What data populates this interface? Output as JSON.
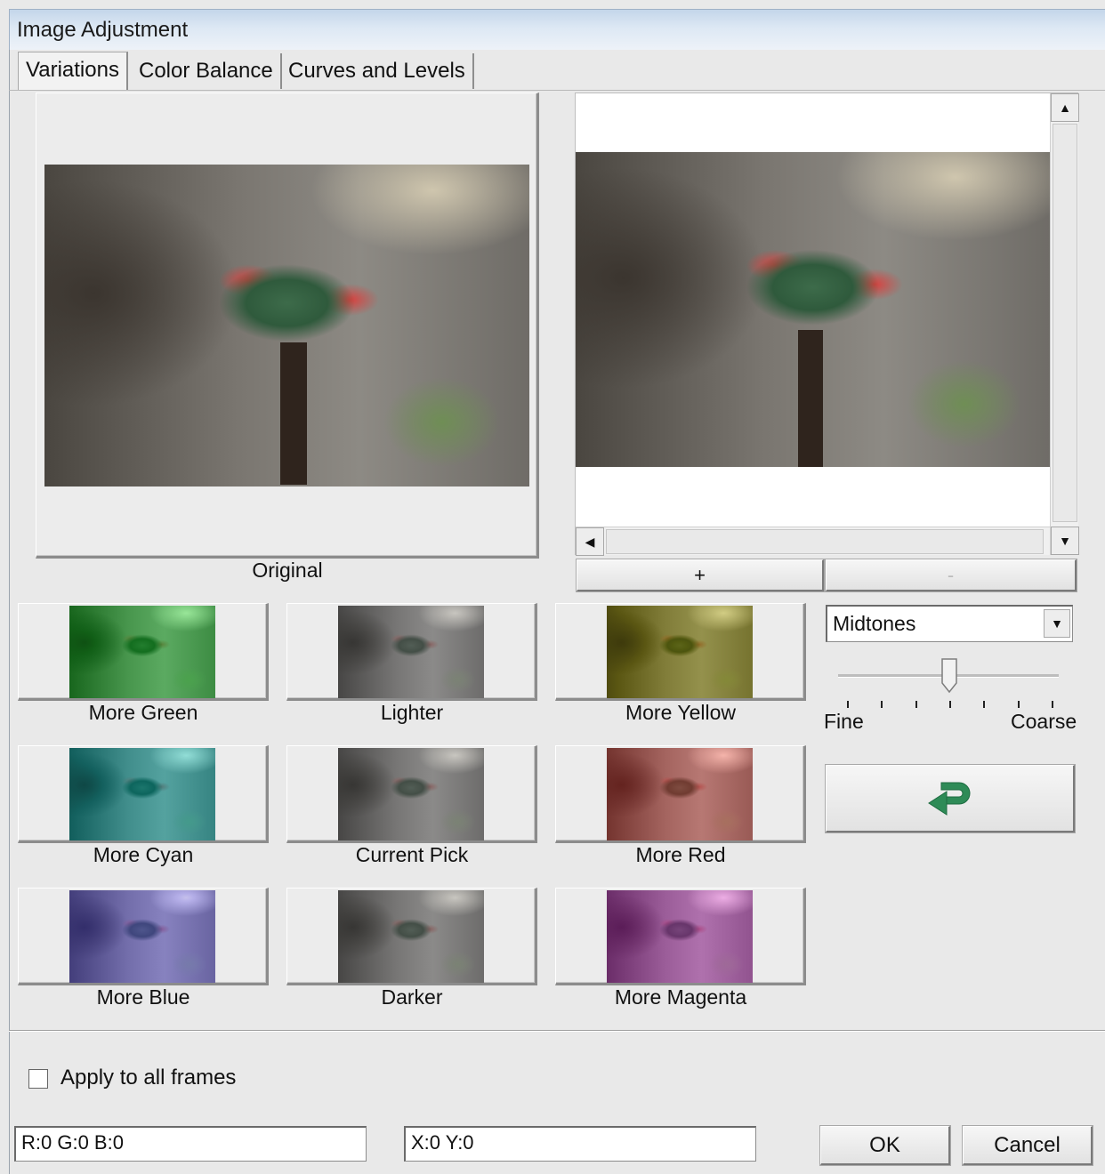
{
  "window": {
    "title": "Image Adjustment"
  },
  "tabs": [
    {
      "label": "Variations",
      "active": true
    },
    {
      "label": "Color Balance",
      "active": false
    },
    {
      "label": "Curves and Levels",
      "active": false
    }
  ],
  "original": {
    "label": "Original"
  },
  "preview": {
    "zoom_in_label": "+",
    "zoom_out_label": "-"
  },
  "variations": [
    {
      "label": "More Green",
      "tint": "#3fa94a"
    },
    {
      "label": "Lighter",
      "tint": "#bdbdbd"
    },
    {
      "label": "More Yellow",
      "tint": "#b7b35a"
    },
    {
      "label": "More Cyan",
      "tint": "#3fa7a6"
    },
    {
      "label": "Current Pick",
      "tint": "#6e6e6e"
    },
    {
      "label": "More Red",
      "tint": "#b25e5a"
    },
    {
      "label": "More Blue",
      "tint": "#5a55a8"
    },
    {
      "label": "Darker",
      "tint": "#3d3d3d"
    },
    {
      "label": "More Magenta",
      "tint": "#a655a6"
    }
  ],
  "tone_select": {
    "value": "Midtones"
  },
  "slider": {
    "fine_label": "Fine",
    "coarse_label": "Coarse",
    "position_fraction": 0.5
  },
  "apply_all": {
    "label": "Apply to all frames",
    "checked": false
  },
  "status": {
    "rgb": "R:0 G:0 B:0",
    "xy": "X:0 Y:0"
  },
  "buttons": {
    "ok": "OK",
    "cancel": "Cancel"
  },
  "colors": {
    "reset_arrow": "#2e8b57"
  }
}
